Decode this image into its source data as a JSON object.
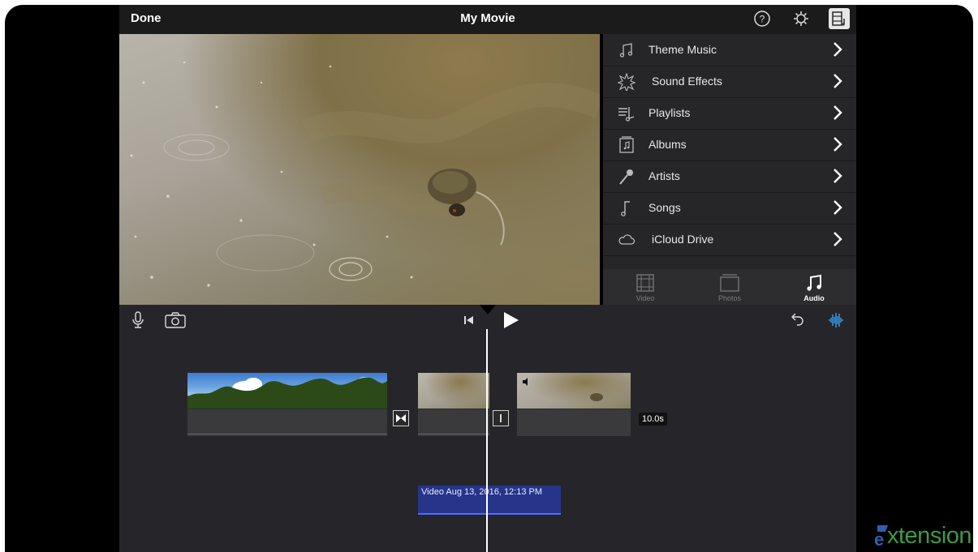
{
  "window": {
    "done_label": "Done",
    "title": "My Movie",
    "icons": [
      "help-icon",
      "settings-icon",
      "media-browser-icon"
    ]
  },
  "browser": {
    "items": [
      {
        "label": "Theme Music",
        "icon": "music-note-icon"
      },
      {
        "label": "Sound Effects",
        "icon": "sound-effects-icon"
      },
      {
        "label": "Playlists",
        "icon": "playlist-icon"
      },
      {
        "label": "Albums",
        "icon": "album-icon"
      },
      {
        "label": "Artists",
        "icon": "microphone-icon"
      },
      {
        "label": "Songs",
        "icon": "song-note-icon"
      },
      {
        "label": "iCloud Drive",
        "icon": "cloud-icon"
      }
    ],
    "tabs": [
      {
        "label": "Video",
        "icon": "film-icon",
        "active": false
      },
      {
        "label": "Photos",
        "icon": "photos-icon",
        "active": false
      },
      {
        "label": "Audio",
        "icon": "audio-note-icon",
        "active": true
      }
    ]
  },
  "timeline": {
    "controls": [
      "microphone-icon",
      "camera-icon",
      "skip-back-icon",
      "play-icon",
      "undo-icon",
      "audio-waveform-icon"
    ],
    "duration_badge": "10.0s",
    "detached_clip_label": "Video Aug 13, 2016, 12:13 PM"
  },
  "watermark": {
    "text": "xtension",
    "accent": "#3d9a45",
    "logo_blue": "#2f5fb0"
  }
}
